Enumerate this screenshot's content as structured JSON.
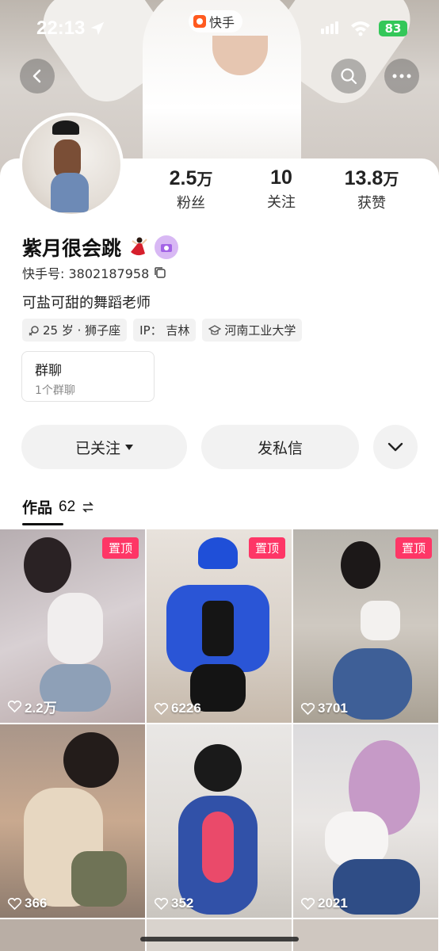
{
  "status_bar": {
    "time": "22:13",
    "app_name": "快手",
    "battery": "83"
  },
  "profile": {
    "name": "紫月很会跳",
    "kuaishou_id": "快手号: 3802187958",
    "bio": "可盐可甜的舞蹈老师",
    "stats": [
      {
        "num": "2.5",
        "unit": "万",
        "label": "粉丝"
      },
      {
        "num": "10",
        "unit": "",
        "label": "关注"
      },
      {
        "num": "13.8",
        "unit": "万",
        "label": "获赞"
      }
    ],
    "tags": [
      {
        "icon": "gender-female-icon",
        "text": "25 岁 · 狮子座"
      },
      {
        "icon": "",
        "text": "IP： 吉林"
      },
      {
        "icon": "graduation-cap-icon",
        "text": "河南工业大学"
      }
    ]
  },
  "group_chat": {
    "title": "群聊",
    "subtitle": "1个群聊"
  },
  "actions": {
    "follow": "已关注",
    "message": "发私信"
  },
  "works_tab": {
    "label": "作品",
    "count": "62"
  },
  "posts": [
    {
      "pinned": "置顶",
      "likes": "2.2万"
    },
    {
      "pinned": "置顶",
      "likes": "6226"
    },
    {
      "pinned": "置顶",
      "likes": "3701"
    },
    {
      "pinned": "",
      "likes": "366"
    },
    {
      "pinned": "",
      "likes": "352"
    },
    {
      "pinned": "",
      "likes": "2021"
    }
  ],
  "colors": {
    "pin_badge": "#fe3666",
    "battery": "#34c759",
    "button_bg": "#f2f2f2"
  }
}
